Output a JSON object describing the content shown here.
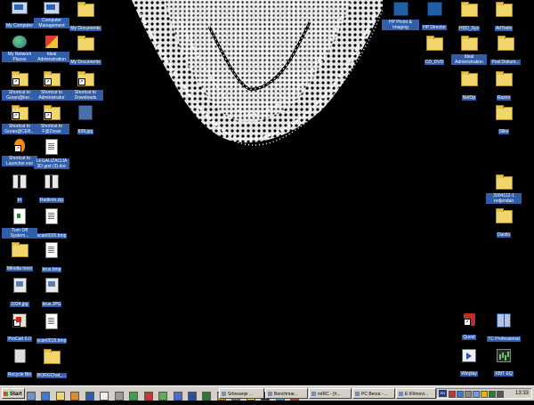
{
  "desktop": {
    "icons_left": [
      {
        "label": "My Computer",
        "icon": "computer-icon"
      },
      {
        "label": "Computer Management",
        "icon": "computer-management-icon"
      },
      {
        "label": "My Documents",
        "icon": "folder-icon"
      },
      {
        "label": "My Network Places",
        "icon": "network-icon"
      },
      {
        "label": "Ideal Administration",
        "icon": "ideal-admin-icon"
      },
      {
        "label": "My Documents",
        "icon": "folder-icon"
      },
      {
        "label": "Shortcut to Goran@ker...",
        "icon": "folder-shortcut-icon"
      },
      {
        "label": "Shortcut to Administrator",
        "icon": "folder-shortcut-icon"
      },
      {
        "label": "Shortcut to Downloads",
        "icon": "folder-shortcut-icon"
      },
      {
        "label": "Shortcut to Goran@CEB...",
        "icon": "folder-shortcut-icon"
      },
      {
        "label": "Shortcut to F@Zoran",
        "icon": "folder-shortcut-icon"
      },
      {
        "label": "839.jpg",
        "icon": "image-file-icon"
      },
      {
        "label": "Shortcut to Launcher.exe",
        "icon": "launcher-icon"
      },
      {
        "label": "LEGALIZACIJA 3D god (3).doc",
        "icon": "word-document-icon"
      },
      {
        "label": "trt",
        "icon": "file-icon"
      },
      {
        "label": "Radikon.zip",
        "icon": "zip-icon"
      },
      {
        "label": "Turn Off System...",
        "icon": "turn-off-icon"
      },
      {
        "label": "scan0020.bmp",
        "icon": "image-file-icon"
      },
      {
        "label": "Minolta novo",
        "icon": "folder-icon"
      },
      {
        "label": "brus.bmp",
        "icon": "image-file-icon"
      },
      {
        "label": "1024.jpg",
        "icon": "image-file-icon"
      },
      {
        "label": "brus.JPG",
        "icon": "image-file-icon"
      },
      {
        "label": "ProCart 6.0",
        "icon": "procart-icon"
      },
      {
        "label": "scan0015.bmp",
        "icon": "image-file-icon"
      },
      {
        "label": "Recycle Bin",
        "icon": "recycle-bin-icon"
      },
      {
        "label": "BORGChat_...",
        "icon": "folder-icon"
      }
    ],
    "icons_right": [
      {
        "label": "HP Photo & Imaging",
        "icon": "hp-photo-icon"
      },
      {
        "label": "HP Director",
        "icon": "hp-director-icon"
      },
      {
        "label": "HDD_Sys",
        "icon": "folder-icon"
      },
      {
        "label": "ArtTools",
        "icon": "folder-icon"
      },
      {
        "label": "CD_DVD",
        "icon": "folder-icon"
      },
      {
        "label": "Ideal Administration",
        "icon": "ideal-admin-icon"
      },
      {
        "label": "Posl.Dokum...",
        "icon": "folder-icon"
      },
      {
        "label": "NetOp",
        "icon": "folder-icon"
      },
      {
        "label": "Razno",
        "icon": "folder-icon"
      },
      {
        "label": "Slike",
        "icon": "folder-icon"
      },
      {
        "label": "2004112-1 rodjendan",
        "icon": "folder-icon"
      },
      {
        "label": "Danilo",
        "icon": "folder-icon"
      },
      {
        "label": "Quest",
        "icon": "quest-icon"
      },
      {
        "label": "TC Professional",
        "icon": "total-commander-icon"
      },
      {
        "label": "Winplay",
        "icon": "winplay-icon"
      },
      {
        "label": "XBIT EQ",
        "icon": "equalizer-icon"
      }
    ]
  },
  "taskbar": {
    "start_label": "Start",
    "tasks": [
      {
        "label": "Srbovanje ...",
        "icon": "window-icon"
      },
      {
        "label": "Benchmar...",
        "icon": "window-icon"
      },
      {
        "label": "mIRC - [#...",
        "icon": "mirc-icon"
      },
      {
        "label": "PC Berza - ...",
        "icon": "browser-icon"
      },
      {
        "label": "E:\\Filmovi...",
        "icon": "folder-window-icon"
      }
    ],
    "tray_language": "EN",
    "clock": "13:33"
  },
  "colors": {
    "desktop_bg": "#000000",
    "label_highlight": "#315ea9",
    "taskbar_bg": "#d4d0c8",
    "folder": "#f1d66b"
  }
}
